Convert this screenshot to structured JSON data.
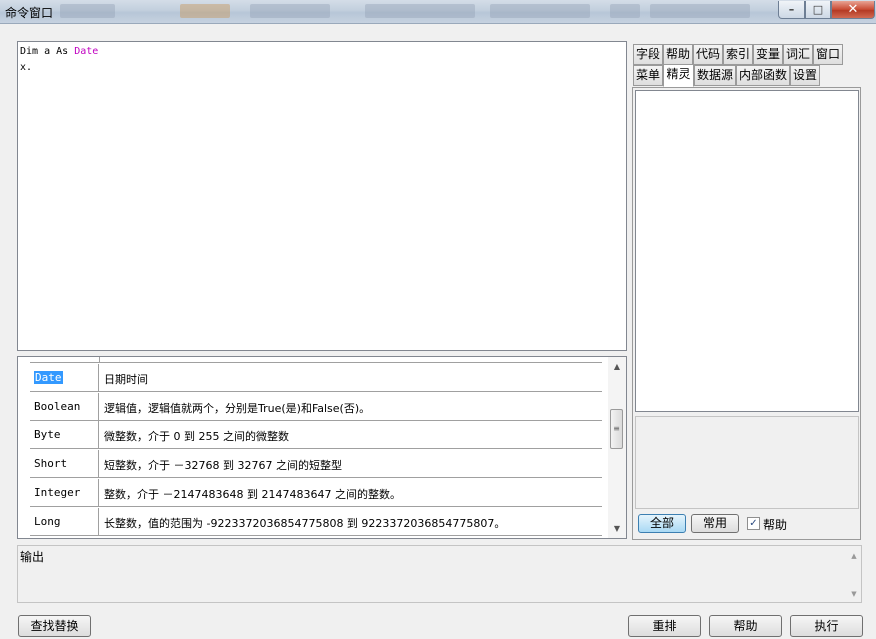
{
  "window": {
    "title": "命令窗口",
    "minimize_glyph": "–",
    "maximize_glyph": "□",
    "close_glyph": "✕"
  },
  "editor": {
    "line1_kw": "Dim a As ",
    "line1_type": "Date",
    "line2": "x."
  },
  "type_list": {
    "rows": [
      {
        "type": "Date",
        "desc": "日期时间",
        "selected": true
      },
      {
        "type": "Boolean",
        "desc": "逻辑值，逻辑值就两个，分别是True(是)和False(否)。",
        "selected": false
      },
      {
        "type": "Byte",
        "desc": "微整数，介于 0 到 255 之间的微整数",
        "selected": false
      },
      {
        "type": "Short",
        "desc": "短整数，介于 －32768 到 32767 之间的短整型",
        "selected": false
      },
      {
        "type": "Integer",
        "desc": "整数，介于 －2147483648 到 2147483647 之间的整数。",
        "selected": false
      },
      {
        "type": "Long",
        "desc": "长整数，值的范围为 -9223372036854775808 到 9223372036854775807。",
        "selected": false
      }
    ],
    "scroll_up": "▲",
    "scroll_down": "▼",
    "thumb_grip": "≡"
  },
  "right_tabs": {
    "row1": [
      "字段",
      "帮助",
      "代码",
      "索引",
      "变量",
      "词汇",
      "窗口"
    ],
    "row2": [
      "菜单",
      "精灵",
      "数据源",
      "内部函数",
      "设置"
    ],
    "active": "精灵"
  },
  "right_panel": {
    "all_button": "全部",
    "common_button": "常用",
    "help_checkbox_label": "帮助",
    "help_checked": true,
    "check_glyph": "✓"
  },
  "output": {
    "label": "输出",
    "scroll_up": "▲",
    "scroll_down": "▼"
  },
  "bottom_buttons": {
    "find_replace": "查找替换",
    "reformat": "重排",
    "help": "帮助",
    "execute": "执行"
  },
  "colors": {
    "selection": "#3399ff",
    "type_keyword": "#c000c0",
    "primary_button": "#a9d9f4"
  }
}
